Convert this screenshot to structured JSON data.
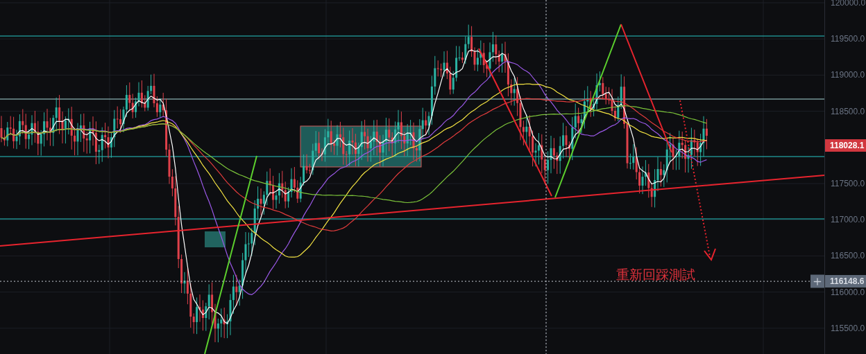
{
  "price_axis": {
    "labels": [
      "120000.0",
      "119500.0",
      "119000.0",
      "118500.0",
      "117500.0",
      "117000.0",
      "116500.0",
      "116000.0",
      "115500.0"
    ]
  },
  "price_tags": [
    {
      "kind": "last",
      "price": "118028.1"
    },
    {
      "kind": "crosshair",
      "price": "116148.6"
    }
  ],
  "annotation": {
    "text": "重新回踩測試"
  }
}
